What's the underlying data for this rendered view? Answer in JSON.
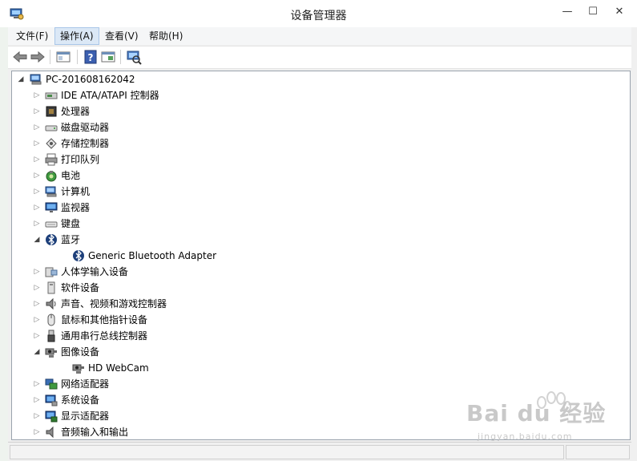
{
  "window": {
    "title": "设备管理器",
    "min_glyph": "—",
    "max_glyph": "☐",
    "close_glyph": "✕"
  },
  "menu": [
    {
      "label": "文件(F)",
      "active": false
    },
    {
      "label": "操作(A)",
      "active": true
    },
    {
      "label": "查看(V)",
      "active": false
    },
    {
      "label": "帮助(H)",
      "active": false
    }
  ],
  "toolbar": [
    "back-icon",
    "forward-icon",
    "show-hide-tree-icon",
    "help-icon",
    "properties-icon",
    "scan-hardware-icon"
  ],
  "tree": {
    "root": "PC-201608162042",
    "items": [
      {
        "label": "IDE ATA/ATAPI 控制器",
        "icon": "ide-controller-icon",
        "expanded": false,
        "level": 1
      },
      {
        "label": "处理器",
        "icon": "processor-icon",
        "expanded": false,
        "level": 1
      },
      {
        "label": "磁盘驱动器",
        "icon": "disk-drive-icon",
        "expanded": false,
        "level": 1
      },
      {
        "label": "存储控制器",
        "icon": "storage-controller-icon",
        "expanded": false,
        "level": 1
      },
      {
        "label": "打印队列",
        "icon": "printer-icon",
        "expanded": false,
        "level": 1
      },
      {
        "label": "电池",
        "icon": "battery-icon",
        "expanded": false,
        "level": 1
      },
      {
        "label": "计算机",
        "icon": "computer-icon",
        "expanded": false,
        "level": 1
      },
      {
        "label": "监视器",
        "icon": "monitor-icon",
        "expanded": false,
        "level": 1
      },
      {
        "label": "键盘",
        "icon": "keyboard-icon",
        "expanded": false,
        "level": 1
      },
      {
        "label": "蓝牙",
        "icon": "bluetooth-icon",
        "expanded": true,
        "level": 1
      },
      {
        "label": "Generic Bluetooth Adapter",
        "icon": "bluetooth-icon",
        "expanded": null,
        "level": 2
      },
      {
        "label": "人体学输入设备",
        "icon": "hid-icon",
        "expanded": false,
        "level": 1
      },
      {
        "label": "软件设备",
        "icon": "software-device-icon",
        "expanded": false,
        "level": 1
      },
      {
        "label": "声音、视频和游戏控制器",
        "icon": "speaker-icon",
        "expanded": false,
        "level": 1
      },
      {
        "label": "鼠标和其他指针设备",
        "icon": "mouse-icon",
        "expanded": false,
        "level": 1
      },
      {
        "label": "通用串行总线控制器",
        "icon": "usb-icon",
        "expanded": false,
        "level": 1
      },
      {
        "label": "图像设备",
        "icon": "camera-icon",
        "expanded": true,
        "level": 1
      },
      {
        "label": "HD WebCam",
        "icon": "camera-icon",
        "expanded": null,
        "level": 2
      },
      {
        "label": "网络适配器",
        "icon": "network-icon",
        "expanded": false,
        "level": 1
      },
      {
        "label": "系统设备",
        "icon": "system-device-icon",
        "expanded": false,
        "level": 1
      },
      {
        "label": "显示适配器",
        "icon": "display-adapter-icon",
        "expanded": false,
        "level": 1
      },
      {
        "label": "音频输入和输出",
        "icon": "audio-io-icon",
        "expanded": false,
        "level": 1
      }
    ]
  },
  "watermark": {
    "big": "Bai du 经验",
    "small": "jingyan.baidu.com"
  },
  "colors": {
    "accent": "#1e5aa8",
    "tree_border": "#9aa3ad",
    "menu_active": "#dbe8f6"
  }
}
